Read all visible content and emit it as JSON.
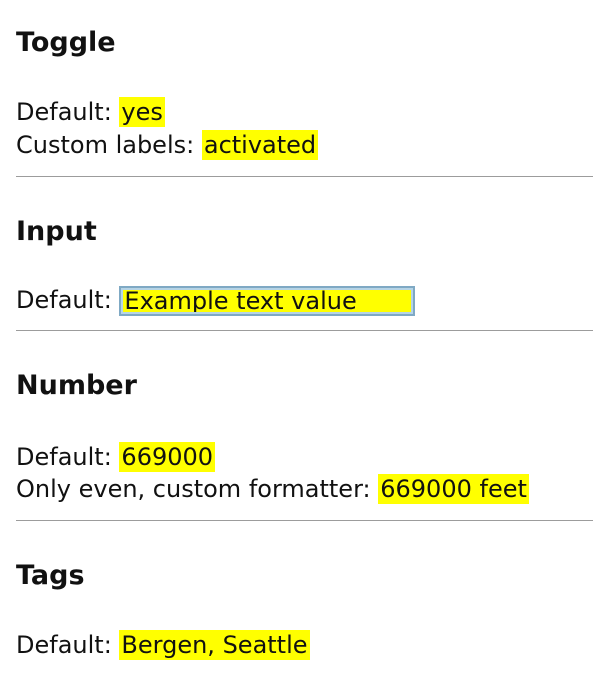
{
  "toggle": {
    "heading": "Toggle",
    "default_label": "Default:",
    "default_value": "yes",
    "custom_label": "Custom labels:",
    "custom_value": "activated"
  },
  "input": {
    "heading": "Input",
    "default_label": "Default:",
    "default_value": "Example text value"
  },
  "number": {
    "heading": "Number",
    "default_label": "Default:",
    "default_value": "669000",
    "even_label": "Only even, custom formatter:",
    "even_value": "669000 feet"
  },
  "tags": {
    "heading": "Tags",
    "default_label": "Default:",
    "default_value": "Bergen, Seattle"
  },
  "colors": {
    "highlight": "#ffff00",
    "divider": "#9c9c9c",
    "input_border": "#7fa9c4"
  }
}
